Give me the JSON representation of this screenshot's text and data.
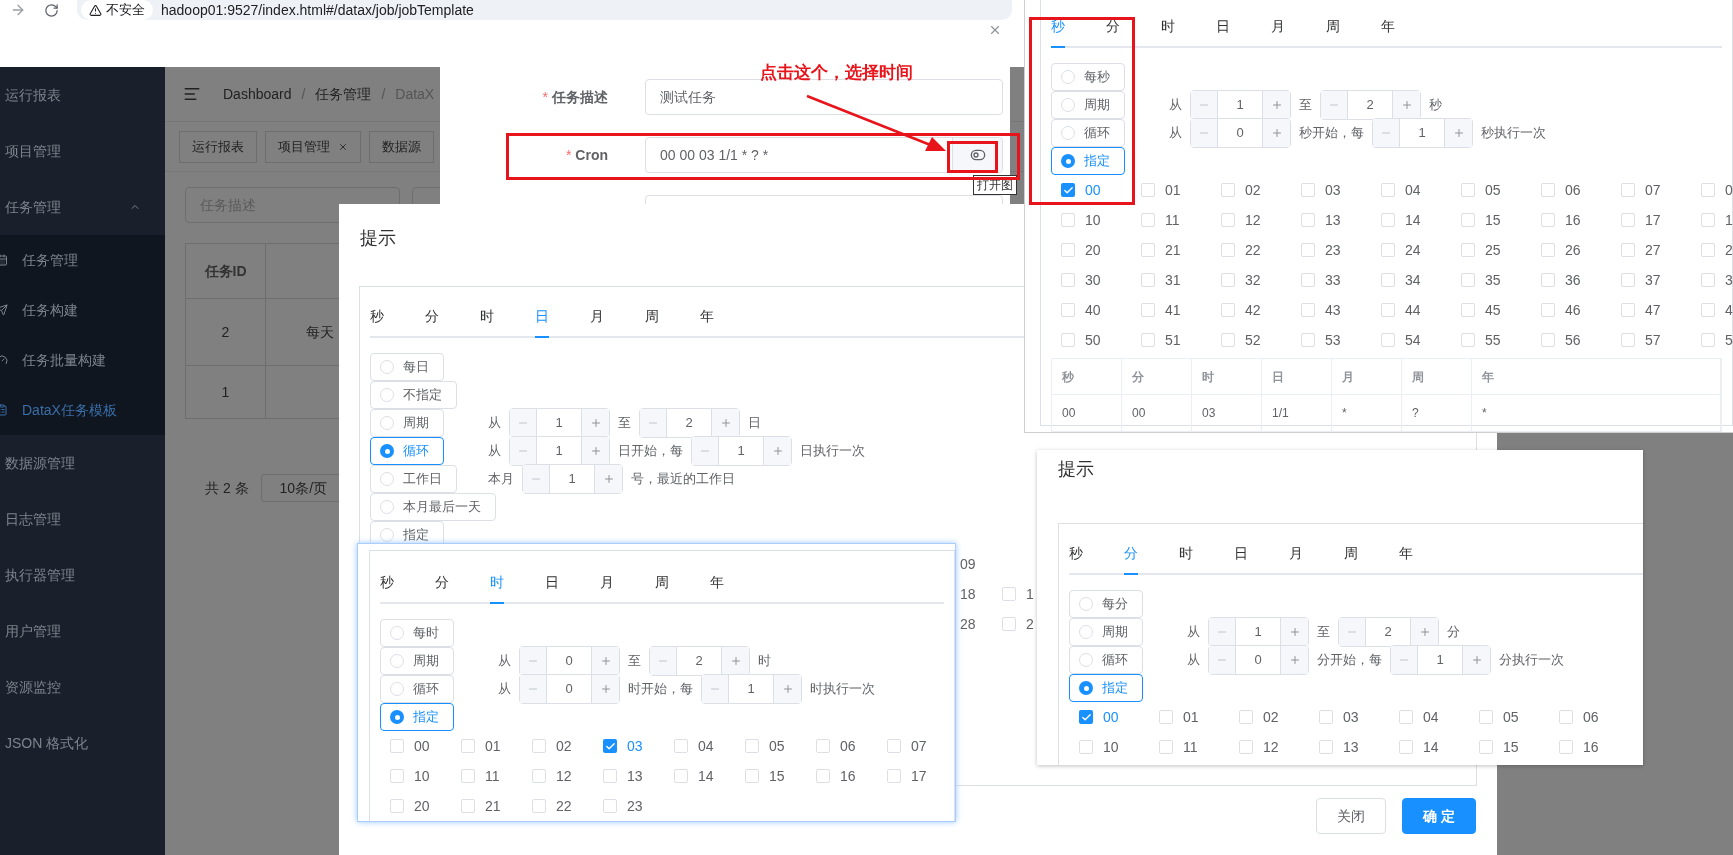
{
  "browser": {
    "security": "不安全",
    "address": "hadoop01:9527/index.html#/datax/job/jobTemplate"
  },
  "sidebar": {
    "items": [
      {
        "label": "运行报表",
        "selected": false
      },
      {
        "label": "项目管理",
        "selected": false
      },
      {
        "label": "任务管理",
        "selected": false,
        "expanded": true,
        "children": [
          {
            "label": "任务管理",
            "selected": false
          },
          {
            "label": "任务构建",
            "selected": false
          },
          {
            "label": "任务批量构建",
            "selected": false
          },
          {
            "label": "DataX任务模板",
            "selected": true
          }
        ]
      },
      {
        "label": "数据源管理",
        "selected": false
      },
      {
        "label": "日志管理",
        "selected": false
      },
      {
        "label": "执行器管理",
        "selected": false
      },
      {
        "label": "用户管理",
        "selected": false
      },
      {
        "label": "资源监控",
        "selected": false
      },
      {
        "label": "JSON 格式化",
        "selected": false
      }
    ]
  },
  "breadcrumbs": [
    "Dashboard",
    "任务管理",
    "DataX"
  ],
  "breadcrumb_separator": "/",
  "tags": [
    {
      "label": "运行报表",
      "closable": false
    },
    {
      "label": "项目管理",
      "closable": true
    },
    {
      "label": "数据源",
      "closable": false
    }
  ],
  "filters": [
    {
      "placeholder": "任务描述"
    }
  ],
  "table": {
    "columns": [
      "任务ID"
    ],
    "rows": [
      {
        "id": "2",
        "column_2": "每天"
      },
      {
        "id": "1"
      }
    ]
  },
  "pagination": {
    "total": "共 2 条",
    "page_size": "10条/页"
  },
  "annotation": "点击这个，选择时间",
  "task_dialog": {
    "fields": [
      {
        "kind": "text",
        "label": "任务描述",
        "required": true,
        "value": "测试任务"
      },
      {
        "kind": "cron",
        "label": "Cron",
        "required": true,
        "value": "00 00 03 1/1 * ? *"
      },
      {
        "kind": "empty"
      }
    ],
    "tooltip": "打开图"
  },
  "day_dialog": {
    "title": "提示",
    "buttons": [
      {
        "label": "关闭",
        "primary": false
      },
      {
        "label": "确 定",
        "primary": true
      }
    ],
    "panel": {
      "tabs": [
        {
          "label": "秒",
          "selected": false
        },
        {
          "label": "分",
          "selected": false
        },
        {
          "label": "时",
          "selected": false
        },
        {
          "label": "日",
          "selected": true
        },
        {
          "label": "月",
          "selected": false
        },
        {
          "label": "周",
          "selected": false
        },
        {
          "label": "年",
          "selected": false
        }
      ],
      "options": [
        {
          "label": "每日",
          "selected": false
        },
        {
          "label": "不指定",
          "selected": false
        },
        {
          "label": "周期",
          "selected": false,
          "parts": [
            {
              "kind": "text",
              "text": "从"
            },
            {
              "kind": "stepper",
              "value": "1"
            },
            {
              "kind": "text",
              "text": "至"
            },
            {
              "kind": "stepper",
              "value": "2"
            },
            {
              "kind": "text",
              "text": "日"
            }
          ]
        },
        {
          "label": "循环",
          "selected": true,
          "parts": [
            {
              "kind": "text",
              "text": "从"
            },
            {
              "kind": "stepper",
              "value": "1"
            },
            {
              "kind": "text",
              "text": "日开始，每"
            },
            {
              "kind": "stepper",
              "value": "1"
            },
            {
              "kind": "text",
              "text": "日执行一次"
            }
          ]
        },
        {
          "label": "工作日",
          "selected": false,
          "parts": [
            {
              "kind": "text",
              "text": "本月"
            },
            {
              "kind": "stepper",
              "value": "1"
            },
            {
              "kind": "text",
              "text": "号，最近的工作日"
            }
          ]
        },
        {
          "label": "本月最后一天",
          "selected": false
        },
        {
          "label": "指定",
          "selected": false
        }
      ],
      "grid": [
        [
          {
            "label": "09"
          }
        ],
        [
          {
            "label": "18"
          },
          {
            "label": "1",
            "checked": false
          }
        ],
        [
          {
            "label": "28"
          },
          {
            "label": "2",
            "checked": false
          }
        ]
      ]
    }
  },
  "hour_panel": {
    "tabs": [
      {
        "label": "秒",
        "selected": false
      },
      {
        "label": "分",
        "selected": false
      },
      {
        "label": "时",
        "selected": true
      },
      {
        "label": "日",
        "selected": false
      },
      {
        "label": "月",
        "selected": false
      },
      {
        "label": "周",
        "selected": false
      },
      {
        "label": "年",
        "selected": false
      }
    ],
    "options": [
      {
        "label": "每时",
        "selected": false
      },
      {
        "label": "周期",
        "selected": false,
        "parts": [
          {
            "kind": "text",
            "text": "从"
          },
          {
            "kind": "stepper",
            "value": "0"
          },
          {
            "kind": "text",
            "text": "至"
          },
          {
            "kind": "stepper",
            "value": "2"
          },
          {
            "kind": "text",
            "text": "时"
          }
        ]
      },
      {
        "label": "循环",
        "selected": false,
        "parts": [
          {
            "kind": "text",
            "text": "从"
          },
          {
            "kind": "stepper",
            "value": "0"
          },
          {
            "kind": "text",
            "text": "时开始，每"
          },
          {
            "kind": "stepper",
            "value": "1"
          },
          {
            "kind": "text",
            "text": "时执行一次"
          }
        ]
      },
      {
        "label": "指定",
        "selected": true
      }
    ],
    "grid": [
      [
        {
          "label": "00",
          "checked": false
        },
        {
          "label": "01",
          "checked": false
        },
        {
          "label": "02",
          "checked": false
        },
        {
          "label": "03",
          "checked": true
        },
        {
          "label": "04",
          "checked": false
        },
        {
          "label": "05",
          "checked": false
        },
        {
          "label": "06",
          "checked": false
        },
        {
          "label": "07",
          "checked": false
        }
      ],
      [
        {
          "label": "10",
          "checked": false
        },
        {
          "label": "11",
          "checked": false
        },
        {
          "label": "12",
          "checked": false
        },
        {
          "label": "13",
          "checked": false
        },
        {
          "label": "14",
          "checked": false
        },
        {
          "label": "15",
          "checked": false
        },
        {
          "label": "16",
          "checked": false
        },
        {
          "label": "17",
          "checked": false
        }
      ],
      [
        {
          "label": "20",
          "checked": false
        },
        {
          "label": "21",
          "checked": false
        },
        {
          "label": "22",
          "checked": false
        },
        {
          "label": "23",
          "checked": false
        }
      ]
    ]
  },
  "second_panel": {
    "tabs": [
      {
        "label": "秒",
        "selected": true
      },
      {
        "label": "分",
        "selected": false
      },
      {
        "label": "时",
        "selected": false
      },
      {
        "label": "日",
        "selected": false
      },
      {
        "label": "月",
        "selected": false
      },
      {
        "label": "周",
        "selected": false
      },
      {
        "label": "年",
        "selected": false
      }
    ],
    "options": [
      {
        "label": "每秒",
        "selected": false
      },
      {
        "label": "周期",
        "selected": false,
        "parts": [
          {
            "kind": "text",
            "text": "从"
          },
          {
            "kind": "stepper",
            "value": "1"
          },
          {
            "kind": "text",
            "text": "至"
          },
          {
            "kind": "stepper",
            "value": "2"
          },
          {
            "kind": "text",
            "text": "秒"
          }
        ]
      },
      {
        "label": "循环",
        "selected": false,
        "parts": [
          {
            "kind": "text",
            "text": "从"
          },
          {
            "kind": "stepper",
            "value": "0"
          },
          {
            "kind": "text",
            "text": "秒开始，每"
          },
          {
            "kind": "stepper",
            "value": "1"
          },
          {
            "kind": "text",
            "text": "秒执行一次"
          }
        ]
      },
      {
        "label": "指定",
        "selected": true
      }
    ],
    "grid": [
      [
        {
          "label": "00",
          "checked": true
        },
        {
          "label": "01",
          "checked": false
        },
        {
          "label": "02",
          "checked": false
        },
        {
          "label": "03",
          "checked": false
        },
        {
          "label": "04",
          "checked": false
        },
        {
          "label": "05",
          "checked": false
        },
        {
          "label": "06",
          "checked": false
        },
        {
          "label": "07",
          "checked": false
        },
        {
          "label": "0",
          "checked": false
        }
      ],
      [
        {
          "label": "10",
          "checked": false
        },
        {
          "label": "11",
          "checked": false
        },
        {
          "label": "12",
          "checked": false
        },
        {
          "label": "13",
          "checked": false
        },
        {
          "label": "14",
          "checked": false
        },
        {
          "label": "15",
          "checked": false
        },
        {
          "label": "16",
          "checked": false
        },
        {
          "label": "17",
          "checked": false
        },
        {
          "label": "1",
          "checked": false
        }
      ],
      [
        {
          "label": "20",
          "checked": false
        },
        {
          "label": "21",
          "checked": false
        },
        {
          "label": "22",
          "checked": false
        },
        {
          "label": "23",
          "checked": false
        },
        {
          "label": "24",
          "checked": false
        },
        {
          "label": "25",
          "checked": false
        },
        {
          "label": "26",
          "checked": false
        },
        {
          "label": "27",
          "checked": false
        },
        {
          "label": "2",
          "checked": false
        }
      ],
      [
        {
          "label": "30",
          "checked": false
        },
        {
          "label": "31",
          "checked": false
        },
        {
          "label": "32",
          "checked": false
        },
        {
          "label": "33",
          "checked": false
        },
        {
          "label": "34",
          "checked": false
        },
        {
          "label": "35",
          "checked": false
        },
        {
          "label": "36",
          "checked": false
        },
        {
          "label": "37",
          "checked": false
        },
        {
          "label": "3",
          "checked": false
        }
      ],
      [
        {
          "label": "40",
          "checked": false
        },
        {
          "label": "41",
          "checked": false
        },
        {
          "label": "42",
          "checked": false
        },
        {
          "label": "43",
          "checked": false
        },
        {
          "label": "44",
          "checked": false
        },
        {
          "label": "45",
          "checked": false
        },
        {
          "label": "46",
          "checked": false
        },
        {
          "label": "47",
          "checked": false
        },
        {
          "label": "4",
          "checked": false
        }
      ],
      [
        {
          "label": "50",
          "checked": false
        },
        {
          "label": "51",
          "checked": false
        },
        {
          "label": "52",
          "checked": false
        },
        {
          "label": "53",
          "checked": false
        },
        {
          "label": "54",
          "checked": false
        },
        {
          "label": "55",
          "checked": false
        },
        {
          "label": "56",
          "checked": false
        },
        {
          "label": "57",
          "checked": false
        },
        {
          "label": "5",
          "checked": false
        }
      ]
    ],
    "result": {
      "columns": [
        "秒",
        "分",
        "时",
        "日",
        "月",
        "周",
        "年"
      ],
      "values": [
        "00",
        "00",
        "03",
        "1/1",
        "*",
        "?",
        "*"
      ]
    }
  },
  "minute_dialog": {
    "title": "提示",
    "panel": {
      "tabs": [
        {
          "label": "秒",
          "selected": false
        },
        {
          "label": "分",
          "selected": true
        },
        {
          "label": "时",
          "selected": false
        },
        {
          "label": "日",
          "selected": false
        },
        {
          "label": "月",
          "selected": false
        },
        {
          "label": "周",
          "selected": false
        },
        {
          "label": "年",
          "selected": false
        }
      ],
      "options": [
        {
          "label": "每分",
          "selected": false
        },
        {
          "label": "周期",
          "selected": false,
          "parts": [
            {
              "kind": "text",
              "text": "从"
            },
            {
              "kind": "stepper",
              "value": "1"
            },
            {
              "kind": "text",
              "text": "至"
            },
            {
              "kind": "stepper",
              "value": "2"
            },
            {
              "kind": "text",
              "text": "分"
            }
          ]
        },
        {
          "label": "循环",
          "selected": false,
          "parts": [
            {
              "kind": "text",
              "text": "从"
            },
            {
              "kind": "stepper",
              "value": "0"
            },
            {
              "kind": "text",
              "text": "分开始，每"
            },
            {
              "kind": "stepper",
              "value": "1"
            },
            {
              "kind": "text",
              "text": "分执行一次"
            }
          ]
        },
        {
          "label": "指定",
          "selected": true
        }
      ],
      "grid": [
        [
          {
            "label": "00",
            "checked": true
          },
          {
            "label": "01",
            "checked": false
          },
          {
            "label": "02",
            "checked": false
          },
          {
            "label": "03",
            "checked": false
          },
          {
            "label": "04",
            "checked": false
          },
          {
            "label": "05",
            "checked": false
          },
          {
            "label": "06",
            "checked": false
          }
        ],
        [
          {
            "label": "10",
            "checked": false
          },
          {
            "label": "11",
            "checked": false
          },
          {
            "label": "12",
            "checked": false
          },
          {
            "label": "13",
            "checked": false
          },
          {
            "label": "14",
            "checked": false
          },
          {
            "label": "15",
            "checked": false
          },
          {
            "label": "16",
            "checked": false
          }
        ]
      ]
    }
  }
}
